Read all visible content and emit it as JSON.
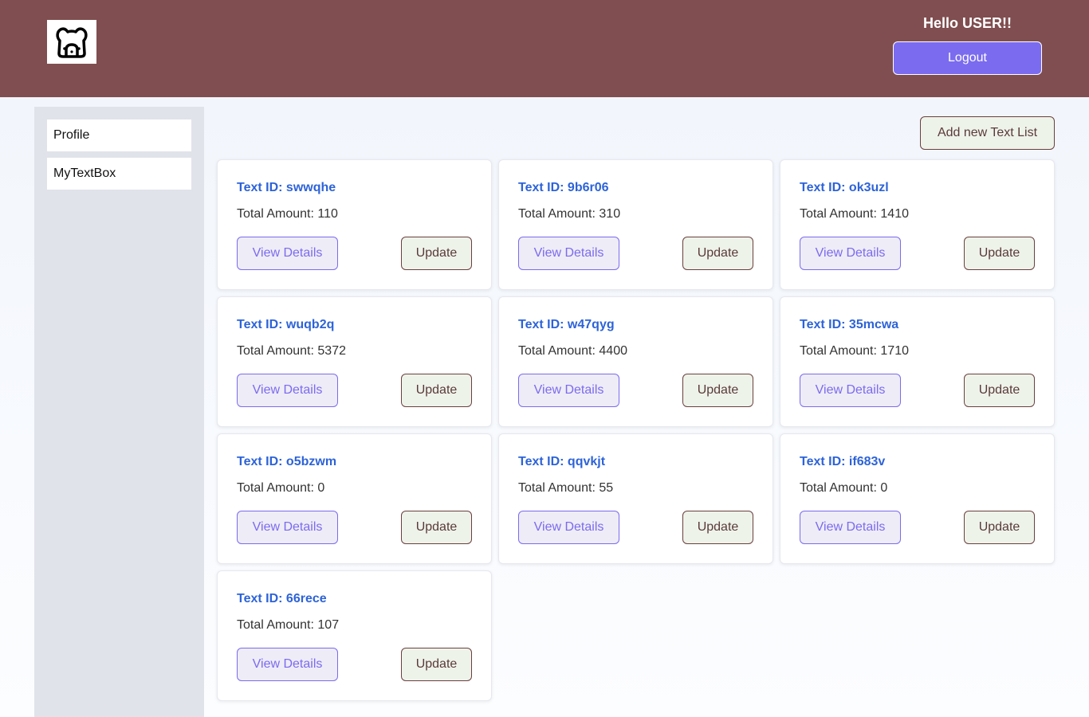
{
  "header": {
    "greeting": "Hello USER!!",
    "logout_label": "Logout",
    "logo_icon": "bear-face-icon"
  },
  "sidebar": {
    "items": [
      {
        "label": "Profile"
      },
      {
        "label": "MyTextBox"
      }
    ]
  },
  "toolbar": {
    "add_label": "Add new Text List"
  },
  "cards": [
    {
      "title": "Text ID: swwqhe",
      "amount": "Total Amount: 110",
      "view_label": "View Details",
      "update_label": "Update"
    },
    {
      "title": "Text ID: 9b6r06",
      "amount": "Total Amount: 310",
      "view_label": "View Details",
      "update_label": "Update"
    },
    {
      "title": "Text ID: ok3uzl",
      "amount": "Total Amount: 1410",
      "view_label": "View Details",
      "update_label": "Update"
    },
    {
      "title": "Text ID: wuqb2q",
      "amount": "Total Amount: 5372",
      "view_label": "View Details",
      "update_label": "Update"
    },
    {
      "title": "Text ID: w47qyg",
      "amount": "Total Amount: 4400",
      "view_label": "View Details",
      "update_label": "Update"
    },
    {
      "title": "Text ID: 35mcwa",
      "amount": "Total Amount: 1710",
      "view_label": "View Details",
      "update_label": "Update"
    },
    {
      "title": "Text ID: o5bzwm",
      "amount": "Total Amount: 0",
      "view_label": "View Details",
      "update_label": "Update"
    },
    {
      "title": "Text ID: qqvkjt",
      "amount": "Total Amount: 55",
      "view_label": "View Details",
      "update_label": "Update"
    },
    {
      "title": "Text ID: if683v",
      "amount": "Total Amount: 0",
      "view_label": "View Details",
      "update_label": "Update"
    },
    {
      "title": "Text ID: 66rece",
      "amount": "Total Amount: 107",
      "view_label": "View Details",
      "update_label": "Update"
    }
  ],
  "colors": {
    "header_bg": "#804e50",
    "accent": "#7b6bef",
    "title_blue": "#2d63d8",
    "update_border": "#6b3f3f"
  }
}
